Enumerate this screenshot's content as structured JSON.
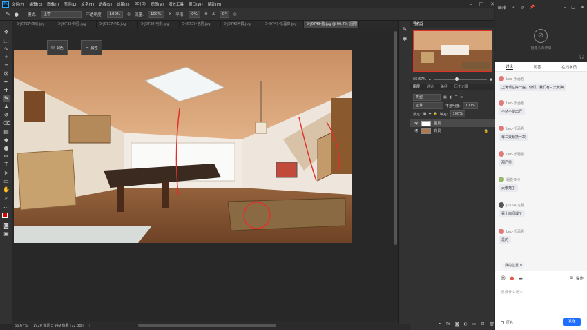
{
  "app": {
    "logo": "Ps"
  },
  "menu": [
    "文件(F)",
    "编辑(E)",
    "图像(I)",
    "图层(L)",
    "文字(Y)",
    "选择(S)",
    "滤镜(T)",
    "3D(D)",
    "视图(V)",
    "增效工具",
    "窗口(W)",
    "帮助(H)"
  ],
  "options": {
    "mode_label": "模式:",
    "mode_value": "正常",
    "opacity_label": "不透明度:",
    "opacity_value": "100%",
    "flow_label": "流量:",
    "flow_value": "100%",
    "smooth_label": "平滑:",
    "smooth_value": "0%",
    "angle_value": "0°"
  },
  "tabs": [
    {
      "label": "5-J6727-西瓜.jpg"
    },
    {
      "label": "5-J6733-林园.jpg"
    },
    {
      "label": "5-J6737-PIE.jpg"
    },
    {
      "label": "5-J6738-电影.jpg"
    },
    {
      "label": "5-J6739-馆居.jpg"
    },
    {
      "label": "5-J6740阿姆.jpg"
    },
    {
      "label": "5-J6747-乐器廊.jpg"
    },
    {
      "label": "5-J6749-懿.jpg @ 66.7% (图层 1, RGB/8#) *"
    }
  ],
  "floating_panels": {
    "panel1": "调色",
    "panel2": "属性"
  },
  "status": {
    "zoom": "66.67%",
    "doc": "1920 像素 x 949 像素 (72 ppi)"
  },
  "navigator": {
    "title": "导航器",
    "zoom": "66.67%"
  },
  "layers_panel": {
    "tabs": [
      "图层",
      "通道",
      "路径",
      "历史记录"
    ],
    "kind": "类型",
    "blend": "正常",
    "opacity_label": "不透明度:",
    "opacity": "100%",
    "lock_label": "锁定:",
    "fill_label": "填充:",
    "fill": "100%",
    "layers": [
      {
        "name": "图层 1"
      },
      {
        "name": "背景"
      }
    ]
  },
  "chat": {
    "header_title": "邮箱",
    "camera_text": "摄像头未开启",
    "tabs": [
      "讨论",
      "问答",
      "在线学员"
    ],
    "messages": [
      {
        "user": "Leo-乐酒晒",
        "text": "上海现在好一些，你们，我们有三天轮换"
      },
      {
        "user": "Leo-乐酒晒",
        "text": "不然不能出行"
      },
      {
        "user": "Leo-乐酒晒",
        "text": "每三天轮换一次"
      },
      {
        "user": "Leo-乐酒晒",
        "text": "那严重"
      },
      {
        "user": "霜旋-9-9",
        "text": "太惨死了"
      },
      {
        "user": "J6754-定明",
        "text": "看上面闷爆了"
      },
      {
        "user": "Leo-乐酒晒",
        "text": "是的"
      }
    ],
    "my_location": "我的位置",
    "input_placeholder": "说点什么吧~",
    "action_label": "操作",
    "checkbox_label": "匿名",
    "send_label": "发送"
  },
  "colors": {
    "accent": "#1e6fff",
    "fg_swatch": "#e00000",
    "bg_swatch": "#000000"
  }
}
